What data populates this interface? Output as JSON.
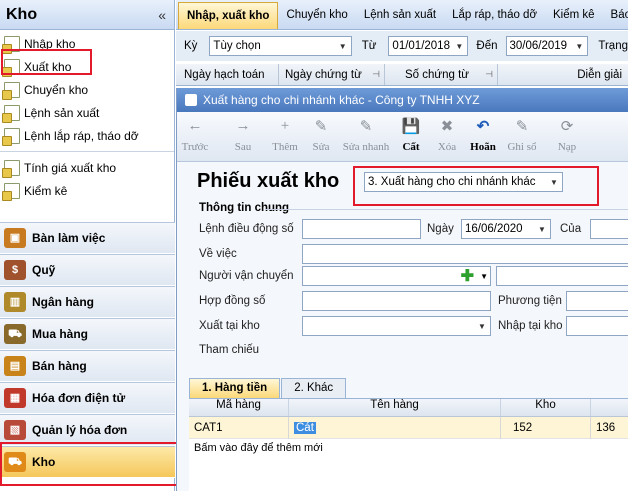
{
  "sidebar": {
    "title": "Kho",
    "collapse": "«",
    "items": [
      {
        "label": "Nhập kho"
      },
      {
        "label": "Xuất kho"
      },
      {
        "label": "Chuyển kho"
      },
      {
        "label": "Lệnh sản xuất"
      },
      {
        "label": "Lệnh lắp ráp, tháo dỡ"
      },
      {
        "label": "Tính giá xuất kho"
      },
      {
        "label": "Kiểm kê"
      }
    ],
    "modules": [
      {
        "label": "Bàn làm việc",
        "color": "#c87a20"
      },
      {
        "label": "Quỹ",
        "color": "#a0522d"
      },
      {
        "label": "Ngân hàng",
        "color": "#b08a2a"
      },
      {
        "label": "Mua hàng",
        "color": "#8a6a2a"
      },
      {
        "label": "Bán hàng",
        "color": "#c8841a"
      },
      {
        "label": "Hóa đơn điện tử",
        "color": "#c0392b"
      },
      {
        "label": "Quản lý hóa đơn",
        "color": "#b84a3a"
      },
      {
        "label": "Kho",
        "color": "#e08a1a"
      }
    ]
  },
  "tabs": [
    "Nhập, xuất kho",
    "Chuyển kho",
    "Lệnh sản xuất",
    "Lắp ráp, tháo dỡ",
    "Kiểm kê",
    "Báo cá"
  ],
  "filter": {
    "ky_label": "Kỳ",
    "ky_value": "Tùy chọn",
    "tu_label": "Từ",
    "tu_value": "01/01/2018",
    "den_label": "Đến",
    "den_value": "30/06/2019",
    "trang_label": "Trạng"
  },
  "grid_headers": [
    "Ngày hạch toán",
    "Ngày chứng từ",
    "Số chứng từ",
    "Diễn giải"
  ],
  "dialog": {
    "title": "Xuất hàng cho chi nhánh khác - Công ty TNHH XYZ",
    "toolbar": [
      {
        "label": "Trước",
        "icon": "←",
        "enabled": false
      },
      {
        "label": "Sau",
        "icon": "→",
        "enabled": false
      },
      {
        "label": "Thêm",
        "icon": "+",
        "enabled": false
      },
      {
        "label": "Sửa",
        "icon": "✎",
        "enabled": false
      },
      {
        "label": "Sửa nhanh",
        "icon": "✎",
        "enabled": false
      },
      {
        "label": "Cất",
        "icon": "💾",
        "enabled": true
      },
      {
        "label": "Xóa",
        "icon": "✖",
        "enabled": false
      },
      {
        "label": "Hoãn",
        "icon": "↶",
        "enabled": true
      },
      {
        "label": "Ghi sổ",
        "icon": "✎",
        "enabled": false
      },
      {
        "label": "Nạp",
        "icon": "⟳",
        "enabled": false
      }
    ],
    "doc_title": "Phiếu xuất kho",
    "type_value": "3. Xuất hàng cho chi nhánh khác",
    "section": "Thông tin chung",
    "fields": {
      "lenh_label": "Lệnh điều động số",
      "ngay_label": "Ngày",
      "ngay_value": "16/06/2020",
      "cua_label": "Của",
      "ve_viec_label": "Về việc",
      "nguoi_vc_label": "Người vận chuyển",
      "hop_dong_label": "Hợp đồng số",
      "phuong_tien_label": "Phương tiện",
      "xuat_tai_label": "Xuất tại kho",
      "nhap_tai_label": "Nhập tại kho",
      "tham_chieu_label": "Tham chiếu"
    },
    "detail_tabs": [
      "1. Hàng tiền",
      "2. Khác"
    ],
    "detail_headers": [
      "Mã hàng",
      "Tên hàng",
      "Kho",
      ""
    ],
    "detail_rows": [
      {
        "ma": "CAT1",
        "ten": "Cát",
        "kho": "152",
        "extra": "136"
      }
    ],
    "add_row": "Bấm vào đây để thêm mới"
  }
}
